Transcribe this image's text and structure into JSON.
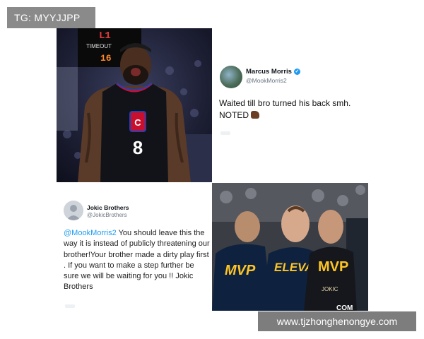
{
  "tag": {
    "text": "TG: MYYJJPP"
  },
  "watermark": {
    "text": "www.tjzhonghenongye.com"
  },
  "photo1": {
    "scoreboard_top": "L1",
    "scoreboard_mid": "TIMEOUT",
    "scoreboard_num": "16",
    "jersey_number": "8"
  },
  "tweet1": {
    "name": "Marcus Morris",
    "handle": "@MookMorris2",
    "text": "Waited till bro turned his back smh. NOTED"
  },
  "tweet2": {
    "name": "Jokic Brothers",
    "handle": "@JokicBrothers",
    "mention": "@MookMorris2",
    "text": " You should leave this the way it is instead of publicly threatening our brother!Your brother made a dirty play first . If you want to make a step further be sure we will be waiting for you !! Jokic Brothers"
  },
  "photo2": {
    "shirt_left": "MVP",
    "shirt_middle": "ELEVA",
    "shirt_right": "MVP",
    "shirt_right_sub": "JOKIC",
    "corner_text": "COM"
  },
  "colors": {
    "verified": "#1d9bf0",
    "mention": "#1d9bf0",
    "nuggets_navy": "#0e2240",
    "nuggets_gold": "#fec524",
    "clippers_red": "#c8102e"
  }
}
